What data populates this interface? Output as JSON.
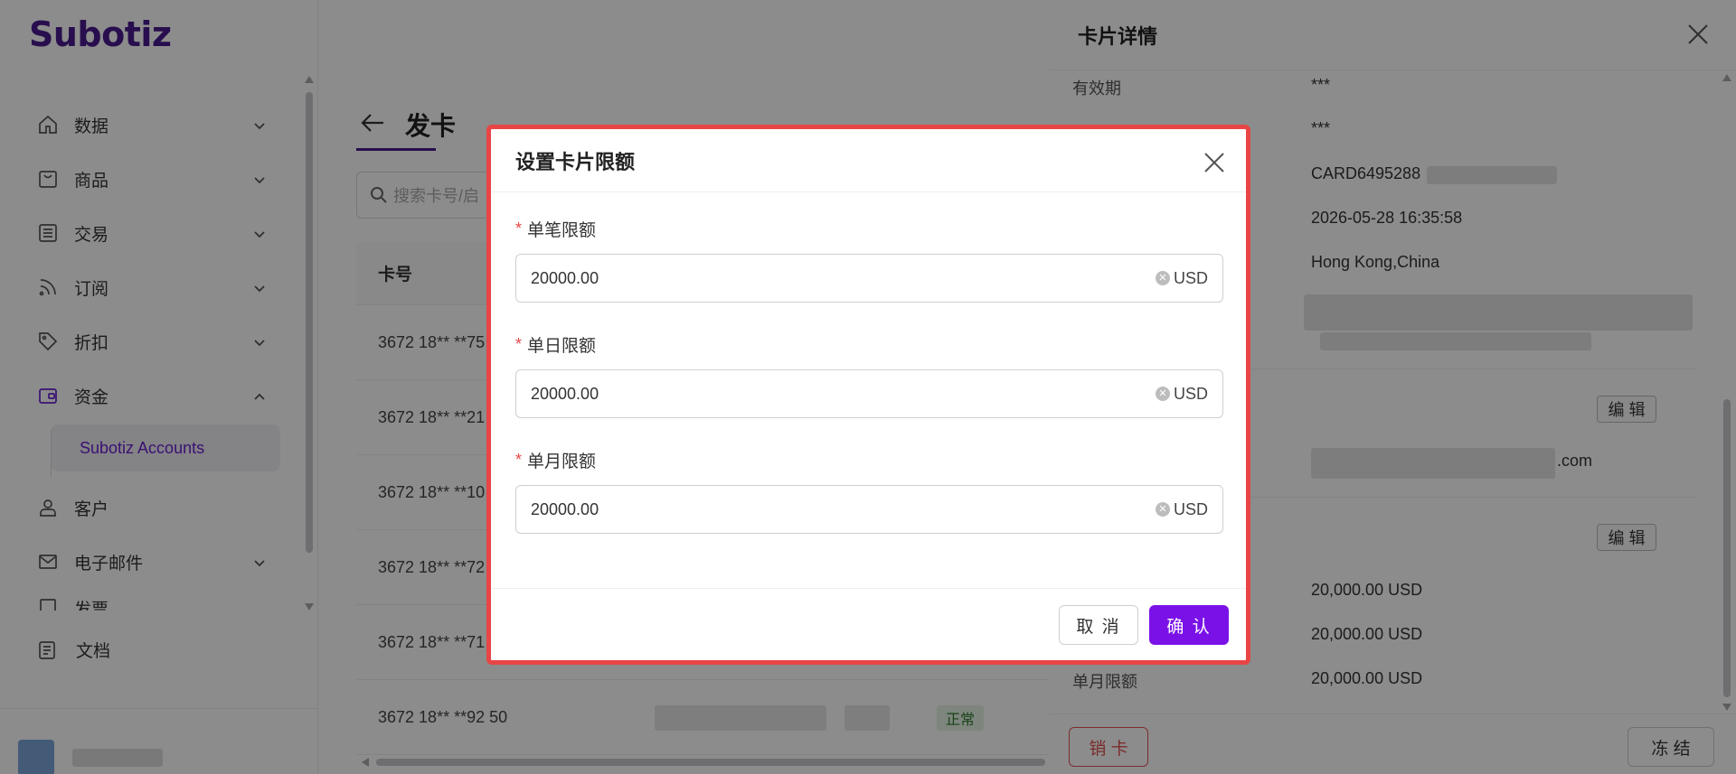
{
  "app": {
    "logo": "Subotiz"
  },
  "sidebar": {
    "items": [
      {
        "label": "数据",
        "icon": "home-icon"
      },
      {
        "label": "商品",
        "icon": "store-icon"
      },
      {
        "label": "交易",
        "icon": "list-icon"
      },
      {
        "label": "订阅",
        "icon": "rss-icon"
      },
      {
        "label": "折扣",
        "icon": "tag-icon"
      },
      {
        "label": "资金",
        "icon": "wallet-icon"
      },
      {
        "label": "客户",
        "icon": "user-icon"
      },
      {
        "label": "电子邮件",
        "icon": "mail-icon"
      },
      {
        "label": "发票",
        "icon": "invoice-icon"
      }
    ],
    "sub_item": "Subotiz Accounts",
    "docs": "文档"
  },
  "main": {
    "title": "发卡",
    "search_placeholder": "搜索卡号/启",
    "table": {
      "header_card": "卡号",
      "rows": [
        {
          "card": "3672 18** **75"
        },
        {
          "card": "3672 18** **21"
        },
        {
          "card": "3672 18** **10"
        },
        {
          "card": "3672 18** **72"
        },
        {
          "card": "3672 18** **71"
        },
        {
          "card": "3672 18** **92 50",
          "status": "正常"
        }
      ]
    }
  },
  "drawer": {
    "title": "卡片详情",
    "rows": [
      {
        "label": "有效期",
        "value": "***"
      },
      {
        "label": "",
        "value": "***"
      },
      {
        "label": "",
        "value": "CARD6495288"
      },
      {
        "label": "",
        "value": "2026-05-28 16:35:58"
      },
      {
        "label": "",
        "value": "Hong Kong,China"
      }
    ],
    "email_suffix": ".com",
    "edit_label": "编 辑",
    "limits": [
      {
        "label": "",
        "value": "20,000.00 USD"
      },
      {
        "label": "",
        "value": "20,000.00 USD"
      },
      {
        "label": "单月限额",
        "value": "20,000.00 USD"
      }
    ],
    "cancel_card": "销 卡",
    "freeze": "冻 结"
  },
  "modal": {
    "title": "设置卡片限额",
    "fields": [
      {
        "label": "单笔限额",
        "value": "20000.00",
        "unit": "USD"
      },
      {
        "label": "单日限额",
        "value": "20000.00",
        "unit": "USD"
      },
      {
        "label": "单月限额",
        "value": "20000.00",
        "unit": "USD"
      }
    ],
    "required_mark": "*",
    "cancel": "取 消",
    "confirm": "确 认"
  },
  "colors": {
    "brand": "#4a1a8e",
    "primary_button": "#7a12e8",
    "highlight_border": "#e84545"
  }
}
